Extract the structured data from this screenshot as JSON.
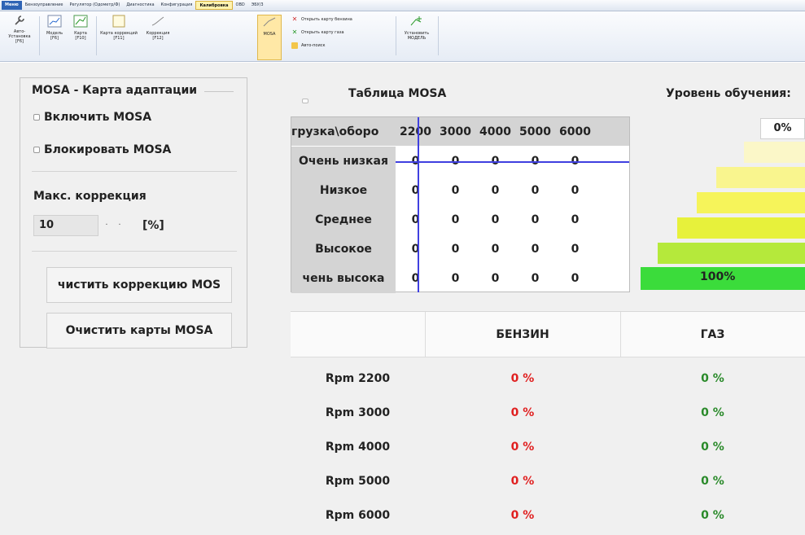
{
  "menubar": {
    "tabs": [
      {
        "label": "Меню",
        "style": "blue"
      },
      {
        "label": "Бензоуправление",
        "style": ""
      },
      {
        "label": "Регулятор (Одометр/Ф)",
        "style": ""
      },
      {
        "label": "Диагностика",
        "style": ""
      },
      {
        "label": "Конфигурация",
        "style": ""
      },
      {
        "label": "Калибровка",
        "style": "active"
      },
      {
        "label": "OBD",
        "style": ""
      },
      {
        "label": "ЭБУ/3",
        "style": ""
      }
    ]
  },
  "toolbar": {
    "auto_setup": {
      "label": "Авто-Установка",
      "key": "[F6]"
    },
    "model": {
      "label": "Модель",
      "key": "[F6]"
    },
    "maps": {
      "label": "Карта",
      "key": "[F10]"
    },
    "corr_maps": {
      "label": "Карта коррекций",
      "key": "[F11]"
    },
    "correction": {
      "label": "Коррекция",
      "key": "[F12]"
    },
    "mosa": {
      "label": "MOSA"
    },
    "open_petrol_map": "Открыть карту бензина",
    "open_gas_map": "Открыть карту газа",
    "auto_search": "Авто-поиск",
    "install_model": {
      "label": "Установить",
      "label2": "МОДЕЛЬ"
    }
  },
  "left_panel": {
    "title": "MOSA - Карта адаптации",
    "enable_mosa": "Включить MOSA",
    "block_mosa": "Блокировать MOSA",
    "max_correction_label": "Макс. коррекция",
    "max_correction_value": "10",
    "spin_up": "·",
    "spin_down": "·",
    "unit": "[%]",
    "clear_correction_button": "чистить коррекцию MOS",
    "clear_maps_button": "Очистить карты MOSA"
  },
  "mosa_table": {
    "title": "Таблица MOSA",
    "corner": "грузка\\оборо",
    "columns": [
      "2200",
      "3000",
      "4000",
      "5000",
      "6000"
    ],
    "rows": [
      {
        "label": "Очень низкая",
        "values": [
          "0",
          "0",
          "0",
          "0",
          "0"
        ]
      },
      {
        "label": "Низкое",
        "values": [
          "0",
          "0",
          "0",
          "0",
          "0"
        ]
      },
      {
        "label": "Среднее",
        "values": [
          "0",
          "0",
          "0",
          "0",
          "0"
        ]
      },
      {
        "label": "Высокое",
        "values": [
          "0",
          "0",
          "0",
          "0",
          "0"
        ]
      },
      {
        "label": "чень высока",
        "values": [
          "0",
          "0",
          "0",
          "0",
          "0"
        ]
      }
    ]
  },
  "learning": {
    "title": "Уровень обучения:",
    "pct_low": "0%",
    "pct_high": "100%",
    "bar_colors": [
      "#fbf7c8",
      "#f9f58e",
      "#f6f45a",
      "#e7f13b",
      "#b5e93b",
      "#3bdc3b"
    ]
  },
  "gas_table": {
    "headers": [
      "",
      "БЕНЗИН",
      "ГАЗ"
    ],
    "rows": [
      {
        "rpm": "Rpm 2200",
        "petrol": "0 %",
        "gas": "0 %"
      },
      {
        "rpm": "Rpm 3000",
        "petrol": "0 %",
        "gas": "0 %"
      },
      {
        "rpm": "Rpm 4000",
        "petrol": "0 %",
        "gas": "0 %"
      },
      {
        "rpm": "Rpm 5000",
        "petrol": "0 %",
        "gas": "0 %"
      },
      {
        "rpm": "Rpm 6000",
        "petrol": "0 %",
        "gas": "0 %"
      }
    ],
    "petrol_color": "#e02020",
    "gas_color": "#2a8a2a"
  }
}
